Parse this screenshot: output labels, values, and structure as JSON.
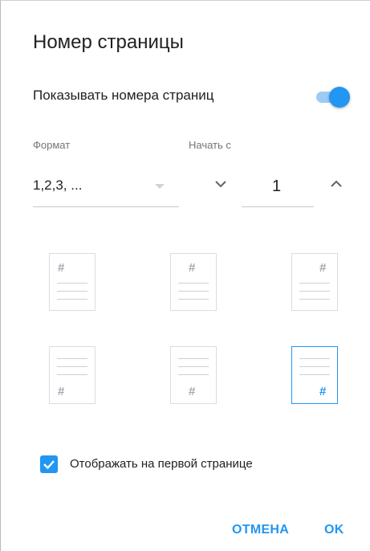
{
  "dialog": {
    "title": "Номер страницы",
    "show_numbers_label": "Показывать номера страниц",
    "show_numbers_on": true
  },
  "format": {
    "label": "Формат",
    "value": "1,2,3, ..."
  },
  "start": {
    "label": "Начать с",
    "value": "1"
  },
  "positions": [
    {
      "name": "top-left",
      "selected": false
    },
    {
      "name": "top-center",
      "selected": false
    },
    {
      "name": "top-right",
      "selected": false
    },
    {
      "name": "bottom-left",
      "selected": false
    },
    {
      "name": "bottom-center",
      "selected": false
    },
    {
      "name": "bottom-right",
      "selected": true
    }
  ],
  "position_glyph": "#",
  "first_page": {
    "label": "Отображать на первой странице",
    "checked": true
  },
  "buttons": {
    "cancel": "ОТМЕНА",
    "ok": "OK"
  },
  "colors": {
    "accent": "#2196f3",
    "accent_light": "#9ccbf5"
  }
}
